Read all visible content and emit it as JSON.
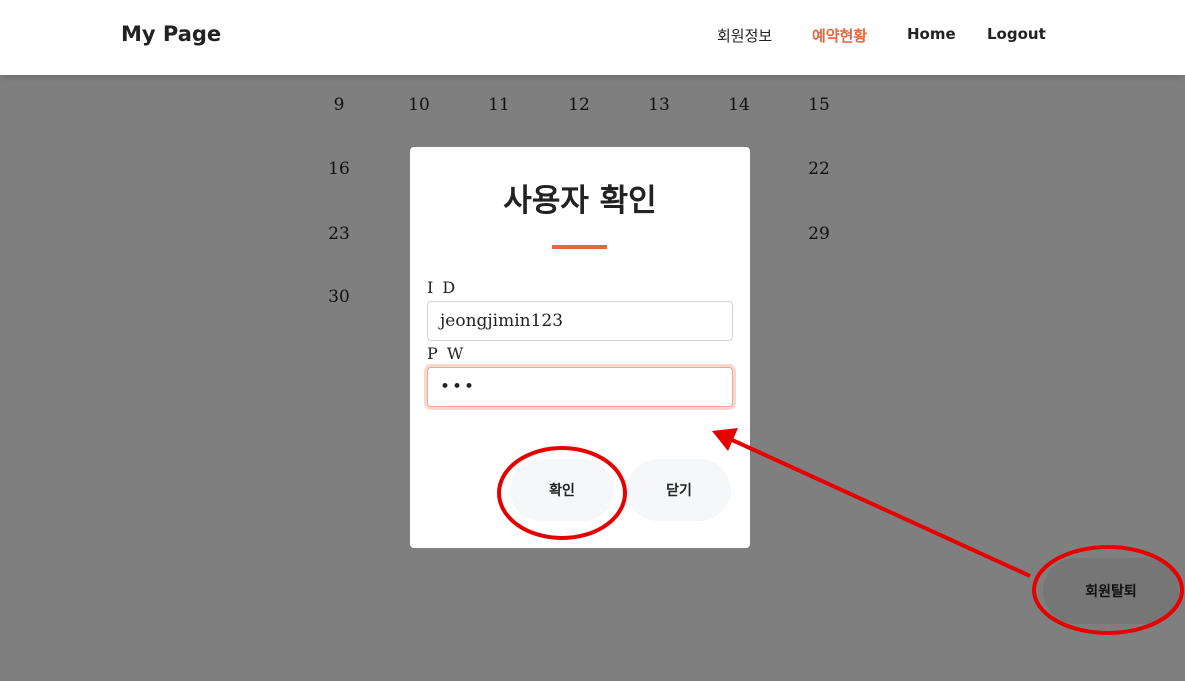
{
  "header": {
    "brand": "My Page",
    "nav": [
      {
        "label": "회원정보",
        "active": false
      },
      {
        "label": "예약현황",
        "active": true
      },
      {
        "label": "Home",
        "active": false
      },
      {
        "label": "Logout",
        "active": false
      }
    ]
  },
  "calendar": {
    "rows": [
      [
        "9",
        "10",
        "11",
        "12",
        "13",
        "14",
        "15"
      ],
      [
        "16",
        "",
        "",
        "",
        "",
        "",
        "22"
      ],
      [
        "23",
        "",
        "",
        "",
        "",
        "",
        "29"
      ],
      [
        "30",
        "",
        "",
        "",
        "",
        "",
        ""
      ]
    ]
  },
  "withdraw_button": "회원탈퇴",
  "modal": {
    "title": "사용자 확인",
    "id_label": "I D",
    "id_value": "jeongjimin123",
    "pw_label": "P W",
    "pw_value": "•••",
    "confirm_label": "확인",
    "close_label": "닫기"
  },
  "colors": {
    "accent": "#e8663d",
    "annotation": "#e60000",
    "overlay": "rgba(0,0,0,0.5)"
  }
}
